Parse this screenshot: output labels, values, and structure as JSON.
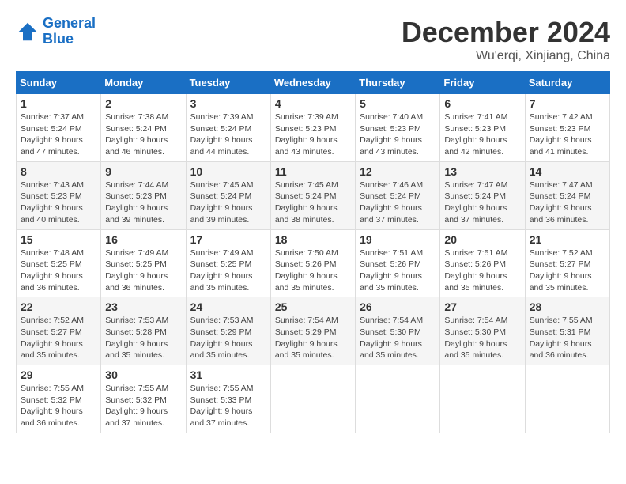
{
  "header": {
    "logo_line1": "General",
    "logo_line2": "Blue",
    "title": "December 2024",
    "subtitle": "Wu'erqi, Xinjiang, China"
  },
  "days_of_week": [
    "Sunday",
    "Monday",
    "Tuesday",
    "Wednesday",
    "Thursday",
    "Friday",
    "Saturday"
  ],
  "weeks": [
    [
      {
        "day": "1",
        "sunrise": "Sunrise: 7:37 AM",
        "sunset": "Sunset: 5:24 PM",
        "daylight": "Daylight: 9 hours and 47 minutes."
      },
      {
        "day": "2",
        "sunrise": "Sunrise: 7:38 AM",
        "sunset": "Sunset: 5:24 PM",
        "daylight": "Daylight: 9 hours and 46 minutes."
      },
      {
        "day": "3",
        "sunrise": "Sunrise: 7:39 AM",
        "sunset": "Sunset: 5:24 PM",
        "daylight": "Daylight: 9 hours and 44 minutes."
      },
      {
        "day": "4",
        "sunrise": "Sunrise: 7:39 AM",
        "sunset": "Sunset: 5:23 PM",
        "daylight": "Daylight: 9 hours and 43 minutes."
      },
      {
        "day": "5",
        "sunrise": "Sunrise: 7:40 AM",
        "sunset": "Sunset: 5:23 PM",
        "daylight": "Daylight: 9 hours and 43 minutes."
      },
      {
        "day": "6",
        "sunrise": "Sunrise: 7:41 AM",
        "sunset": "Sunset: 5:23 PM",
        "daylight": "Daylight: 9 hours and 42 minutes."
      },
      {
        "day": "7",
        "sunrise": "Sunrise: 7:42 AM",
        "sunset": "Sunset: 5:23 PM",
        "daylight": "Daylight: 9 hours and 41 minutes."
      }
    ],
    [
      {
        "day": "8",
        "sunrise": "Sunrise: 7:43 AM",
        "sunset": "Sunset: 5:23 PM",
        "daylight": "Daylight: 9 hours and 40 minutes."
      },
      {
        "day": "9",
        "sunrise": "Sunrise: 7:44 AM",
        "sunset": "Sunset: 5:23 PM",
        "daylight": "Daylight: 9 hours and 39 minutes."
      },
      {
        "day": "10",
        "sunrise": "Sunrise: 7:45 AM",
        "sunset": "Sunset: 5:24 PM",
        "daylight": "Daylight: 9 hours and 39 minutes."
      },
      {
        "day": "11",
        "sunrise": "Sunrise: 7:45 AM",
        "sunset": "Sunset: 5:24 PM",
        "daylight": "Daylight: 9 hours and 38 minutes."
      },
      {
        "day": "12",
        "sunrise": "Sunrise: 7:46 AM",
        "sunset": "Sunset: 5:24 PM",
        "daylight": "Daylight: 9 hours and 37 minutes."
      },
      {
        "day": "13",
        "sunrise": "Sunrise: 7:47 AM",
        "sunset": "Sunset: 5:24 PM",
        "daylight": "Daylight: 9 hours and 37 minutes."
      },
      {
        "day": "14",
        "sunrise": "Sunrise: 7:47 AM",
        "sunset": "Sunset: 5:24 PM",
        "daylight": "Daylight: 9 hours and 36 minutes."
      }
    ],
    [
      {
        "day": "15",
        "sunrise": "Sunrise: 7:48 AM",
        "sunset": "Sunset: 5:25 PM",
        "daylight": "Daylight: 9 hours and 36 minutes."
      },
      {
        "day": "16",
        "sunrise": "Sunrise: 7:49 AM",
        "sunset": "Sunset: 5:25 PM",
        "daylight": "Daylight: 9 hours and 36 minutes."
      },
      {
        "day": "17",
        "sunrise": "Sunrise: 7:49 AM",
        "sunset": "Sunset: 5:25 PM",
        "daylight": "Daylight: 9 hours and 35 minutes."
      },
      {
        "day": "18",
        "sunrise": "Sunrise: 7:50 AM",
        "sunset": "Sunset: 5:26 PM",
        "daylight": "Daylight: 9 hours and 35 minutes."
      },
      {
        "day": "19",
        "sunrise": "Sunrise: 7:51 AM",
        "sunset": "Sunset: 5:26 PM",
        "daylight": "Daylight: 9 hours and 35 minutes."
      },
      {
        "day": "20",
        "sunrise": "Sunrise: 7:51 AM",
        "sunset": "Sunset: 5:26 PM",
        "daylight": "Daylight: 9 hours and 35 minutes."
      },
      {
        "day": "21",
        "sunrise": "Sunrise: 7:52 AM",
        "sunset": "Sunset: 5:27 PM",
        "daylight": "Daylight: 9 hours and 35 minutes."
      }
    ],
    [
      {
        "day": "22",
        "sunrise": "Sunrise: 7:52 AM",
        "sunset": "Sunset: 5:27 PM",
        "daylight": "Daylight: 9 hours and 35 minutes."
      },
      {
        "day": "23",
        "sunrise": "Sunrise: 7:53 AM",
        "sunset": "Sunset: 5:28 PM",
        "daylight": "Daylight: 9 hours and 35 minutes."
      },
      {
        "day": "24",
        "sunrise": "Sunrise: 7:53 AM",
        "sunset": "Sunset: 5:29 PM",
        "daylight": "Daylight: 9 hours and 35 minutes."
      },
      {
        "day": "25",
        "sunrise": "Sunrise: 7:54 AM",
        "sunset": "Sunset: 5:29 PM",
        "daylight": "Daylight: 9 hours and 35 minutes."
      },
      {
        "day": "26",
        "sunrise": "Sunrise: 7:54 AM",
        "sunset": "Sunset: 5:30 PM",
        "daylight": "Daylight: 9 hours and 35 minutes."
      },
      {
        "day": "27",
        "sunrise": "Sunrise: 7:54 AM",
        "sunset": "Sunset: 5:30 PM",
        "daylight": "Daylight: 9 hours and 35 minutes."
      },
      {
        "day": "28",
        "sunrise": "Sunrise: 7:55 AM",
        "sunset": "Sunset: 5:31 PM",
        "daylight": "Daylight: 9 hours and 36 minutes."
      }
    ],
    [
      {
        "day": "29",
        "sunrise": "Sunrise: 7:55 AM",
        "sunset": "Sunset: 5:32 PM",
        "daylight": "Daylight: 9 hours and 36 minutes."
      },
      {
        "day": "30",
        "sunrise": "Sunrise: 7:55 AM",
        "sunset": "Sunset: 5:32 PM",
        "daylight": "Daylight: 9 hours and 37 minutes."
      },
      {
        "day": "31",
        "sunrise": "Sunrise: 7:55 AM",
        "sunset": "Sunset: 5:33 PM",
        "daylight": "Daylight: 9 hours and 37 minutes."
      },
      null,
      null,
      null,
      null
    ]
  ]
}
